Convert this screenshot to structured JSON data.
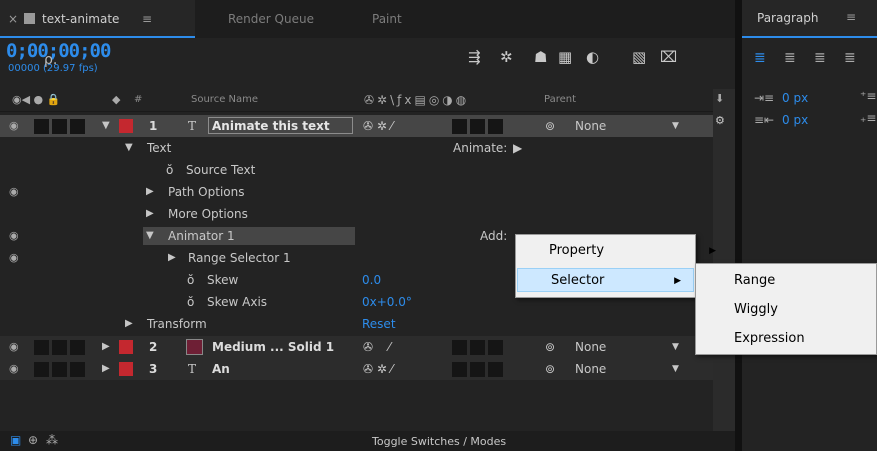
{
  "tabs": {
    "composition": "text-animate",
    "render_queue": "Render Queue",
    "paint": "Paint",
    "paragraph": "Paragraph"
  },
  "timecode": "0;00;00;00",
  "fps": "00000 (29.97 fps)",
  "search_glyph": "ρ.",
  "columns": {
    "hash": "#",
    "source_name": "Source Name",
    "parent": "Parent"
  },
  "layers": [
    {
      "num": "1",
      "name": "Animate this text",
      "parent": "None"
    },
    {
      "num": "2",
      "name": "Medium ... Solid 1",
      "parent": "None"
    },
    {
      "num": "3",
      "name": "An",
      "parent": "None"
    }
  ],
  "props": {
    "text": "Text",
    "animate_label": "Animate:",
    "source_text": "Source Text",
    "path_options": "Path Options",
    "more_options": "More Options",
    "animator": "Animator 1",
    "add_label": "Add:",
    "range_selector": "Range Selector 1",
    "skew": "Skew",
    "skew_value": "0.0",
    "skew_axis": "Skew Axis",
    "skew_axis_value": "0x+0.0°",
    "transform": "Transform",
    "reset": "Reset"
  },
  "context_menu": {
    "property": "Property",
    "selector": "Selector"
  },
  "submenu": {
    "range": "Range",
    "wiggly": "Wiggly",
    "expression": "Expression"
  },
  "footer": {
    "toggle": "Toggle Switches / Modes"
  },
  "paragraph": {
    "indent_left": "0 px",
    "indent_first": "0 px"
  },
  "colors": {
    "accent": "#2d8ceb",
    "label_red": "#c4282f",
    "solid_color": "#6e1f35"
  }
}
